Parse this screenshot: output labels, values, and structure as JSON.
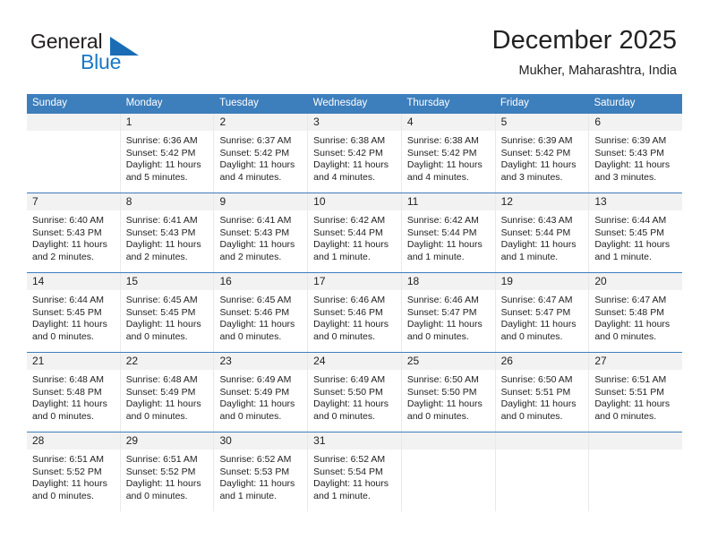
{
  "brand": {
    "name_top": "General",
    "name_bottom": "Blue",
    "accent_color": "#1878c6",
    "triangle_color": "#1a6db5"
  },
  "header": {
    "title": "December 2025",
    "location": "Mukher, Maharashtra, India"
  },
  "calendar": {
    "header_bg": "#3d7ebc",
    "day_band_bg": "#f2f2f2",
    "weekdays": [
      "Sunday",
      "Monday",
      "Tuesday",
      "Wednesday",
      "Thursday",
      "Friday",
      "Saturday"
    ],
    "weeks": [
      [
        {
          "day": "",
          "sunrise": "",
          "sunset": "",
          "daylight_line1": "",
          "daylight_line2": ""
        },
        {
          "day": "1",
          "sunrise": "Sunrise: 6:36 AM",
          "sunset": "Sunset: 5:42 PM",
          "daylight_line1": "Daylight: 11 hours",
          "daylight_line2": "and 5 minutes."
        },
        {
          "day": "2",
          "sunrise": "Sunrise: 6:37 AM",
          "sunset": "Sunset: 5:42 PM",
          "daylight_line1": "Daylight: 11 hours",
          "daylight_line2": "and 4 minutes."
        },
        {
          "day": "3",
          "sunrise": "Sunrise: 6:38 AM",
          "sunset": "Sunset: 5:42 PM",
          "daylight_line1": "Daylight: 11 hours",
          "daylight_line2": "and 4 minutes."
        },
        {
          "day": "4",
          "sunrise": "Sunrise: 6:38 AM",
          "sunset": "Sunset: 5:42 PM",
          "daylight_line1": "Daylight: 11 hours",
          "daylight_line2": "and 4 minutes."
        },
        {
          "day": "5",
          "sunrise": "Sunrise: 6:39 AM",
          "sunset": "Sunset: 5:42 PM",
          "daylight_line1": "Daylight: 11 hours",
          "daylight_line2": "and 3 minutes."
        },
        {
          "day": "6",
          "sunrise": "Sunrise: 6:39 AM",
          "sunset": "Sunset: 5:43 PM",
          "daylight_line1": "Daylight: 11 hours",
          "daylight_line2": "and 3 minutes."
        }
      ],
      [
        {
          "day": "7",
          "sunrise": "Sunrise: 6:40 AM",
          "sunset": "Sunset: 5:43 PM",
          "daylight_line1": "Daylight: 11 hours",
          "daylight_line2": "and 2 minutes."
        },
        {
          "day": "8",
          "sunrise": "Sunrise: 6:41 AM",
          "sunset": "Sunset: 5:43 PM",
          "daylight_line1": "Daylight: 11 hours",
          "daylight_line2": "and 2 minutes."
        },
        {
          "day": "9",
          "sunrise": "Sunrise: 6:41 AM",
          "sunset": "Sunset: 5:43 PM",
          "daylight_line1": "Daylight: 11 hours",
          "daylight_line2": "and 2 minutes."
        },
        {
          "day": "10",
          "sunrise": "Sunrise: 6:42 AM",
          "sunset": "Sunset: 5:44 PM",
          "daylight_line1": "Daylight: 11 hours",
          "daylight_line2": "and 1 minute."
        },
        {
          "day": "11",
          "sunrise": "Sunrise: 6:42 AM",
          "sunset": "Sunset: 5:44 PM",
          "daylight_line1": "Daylight: 11 hours",
          "daylight_line2": "and 1 minute."
        },
        {
          "day": "12",
          "sunrise": "Sunrise: 6:43 AM",
          "sunset": "Sunset: 5:44 PM",
          "daylight_line1": "Daylight: 11 hours",
          "daylight_line2": "and 1 minute."
        },
        {
          "day": "13",
          "sunrise": "Sunrise: 6:44 AM",
          "sunset": "Sunset: 5:45 PM",
          "daylight_line1": "Daylight: 11 hours",
          "daylight_line2": "and 1 minute."
        }
      ],
      [
        {
          "day": "14",
          "sunrise": "Sunrise: 6:44 AM",
          "sunset": "Sunset: 5:45 PM",
          "daylight_line1": "Daylight: 11 hours",
          "daylight_line2": "and 0 minutes."
        },
        {
          "day": "15",
          "sunrise": "Sunrise: 6:45 AM",
          "sunset": "Sunset: 5:45 PM",
          "daylight_line1": "Daylight: 11 hours",
          "daylight_line2": "and 0 minutes."
        },
        {
          "day": "16",
          "sunrise": "Sunrise: 6:45 AM",
          "sunset": "Sunset: 5:46 PM",
          "daylight_line1": "Daylight: 11 hours",
          "daylight_line2": "and 0 minutes."
        },
        {
          "day": "17",
          "sunrise": "Sunrise: 6:46 AM",
          "sunset": "Sunset: 5:46 PM",
          "daylight_line1": "Daylight: 11 hours",
          "daylight_line2": "and 0 minutes."
        },
        {
          "day": "18",
          "sunrise": "Sunrise: 6:46 AM",
          "sunset": "Sunset: 5:47 PM",
          "daylight_line1": "Daylight: 11 hours",
          "daylight_line2": "and 0 minutes."
        },
        {
          "day": "19",
          "sunrise": "Sunrise: 6:47 AM",
          "sunset": "Sunset: 5:47 PM",
          "daylight_line1": "Daylight: 11 hours",
          "daylight_line2": "and 0 minutes."
        },
        {
          "day": "20",
          "sunrise": "Sunrise: 6:47 AM",
          "sunset": "Sunset: 5:48 PM",
          "daylight_line1": "Daylight: 11 hours",
          "daylight_line2": "and 0 minutes."
        }
      ],
      [
        {
          "day": "21",
          "sunrise": "Sunrise: 6:48 AM",
          "sunset": "Sunset: 5:48 PM",
          "daylight_line1": "Daylight: 11 hours",
          "daylight_line2": "and 0 minutes."
        },
        {
          "day": "22",
          "sunrise": "Sunrise: 6:48 AM",
          "sunset": "Sunset: 5:49 PM",
          "daylight_line1": "Daylight: 11 hours",
          "daylight_line2": "and 0 minutes."
        },
        {
          "day": "23",
          "sunrise": "Sunrise: 6:49 AM",
          "sunset": "Sunset: 5:49 PM",
          "daylight_line1": "Daylight: 11 hours",
          "daylight_line2": "and 0 minutes."
        },
        {
          "day": "24",
          "sunrise": "Sunrise: 6:49 AM",
          "sunset": "Sunset: 5:50 PM",
          "daylight_line1": "Daylight: 11 hours",
          "daylight_line2": "and 0 minutes."
        },
        {
          "day": "25",
          "sunrise": "Sunrise: 6:50 AM",
          "sunset": "Sunset: 5:50 PM",
          "daylight_line1": "Daylight: 11 hours",
          "daylight_line2": "and 0 minutes."
        },
        {
          "day": "26",
          "sunrise": "Sunrise: 6:50 AM",
          "sunset": "Sunset: 5:51 PM",
          "daylight_line1": "Daylight: 11 hours",
          "daylight_line2": "and 0 minutes."
        },
        {
          "day": "27",
          "sunrise": "Sunrise: 6:51 AM",
          "sunset": "Sunset: 5:51 PM",
          "daylight_line1": "Daylight: 11 hours",
          "daylight_line2": "and 0 minutes."
        }
      ],
      [
        {
          "day": "28",
          "sunrise": "Sunrise: 6:51 AM",
          "sunset": "Sunset: 5:52 PM",
          "daylight_line1": "Daylight: 11 hours",
          "daylight_line2": "and 0 minutes."
        },
        {
          "day": "29",
          "sunrise": "Sunrise: 6:51 AM",
          "sunset": "Sunset: 5:52 PM",
          "daylight_line1": "Daylight: 11 hours",
          "daylight_line2": "and 0 minutes."
        },
        {
          "day": "30",
          "sunrise": "Sunrise: 6:52 AM",
          "sunset": "Sunset: 5:53 PM",
          "daylight_line1": "Daylight: 11 hours",
          "daylight_line2": "and 1 minute."
        },
        {
          "day": "31",
          "sunrise": "Sunrise: 6:52 AM",
          "sunset": "Sunset: 5:54 PM",
          "daylight_line1": "Daylight: 11 hours",
          "daylight_line2": "and 1 minute."
        },
        {
          "day": "",
          "sunrise": "",
          "sunset": "",
          "daylight_line1": "",
          "daylight_line2": ""
        },
        {
          "day": "",
          "sunrise": "",
          "sunset": "",
          "daylight_line1": "",
          "daylight_line2": ""
        },
        {
          "day": "",
          "sunrise": "",
          "sunset": "",
          "daylight_line1": "",
          "daylight_line2": ""
        }
      ]
    ]
  }
}
